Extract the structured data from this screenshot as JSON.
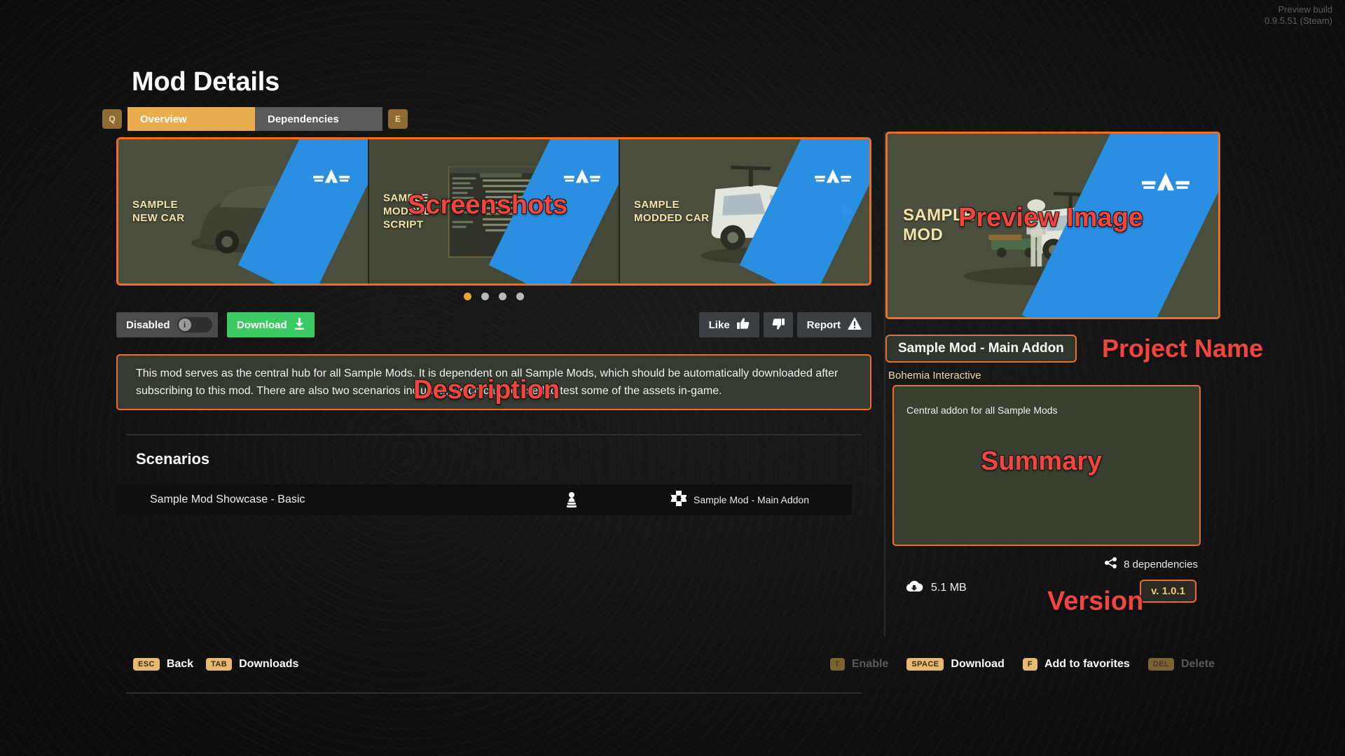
{
  "build": {
    "line1": "Preview build",
    "line2": "0.9.5.51 (Steam)"
  },
  "header": {
    "title": "Mod Details"
  },
  "tabs": {
    "left_key": "Q",
    "right_key": "E",
    "items": [
      {
        "label": "Overview",
        "active": true
      },
      {
        "label": "Dependencies",
        "active": false
      }
    ]
  },
  "carousel": {
    "shots": [
      {
        "label_line1": "SAMPLE",
        "label_line2": "NEW CAR"
      },
      {
        "label_line1": "SAMPLE",
        "label_line2": "MODDED",
        "label_line3": "SCRIPT"
      },
      {
        "label_line1": "SAMPLE",
        "label_line2": "MODDED CAR"
      }
    ],
    "dots": 4,
    "active_dot": 0,
    "next_icon": "chevron-right-icon"
  },
  "actions": {
    "toggle_label": "Disabled",
    "toggle_icon": "info-icon",
    "toggle_state": "off",
    "download_label": "Download",
    "download_icon": "download-icon",
    "like_label": "Like",
    "like_icon": "thumbs-up-icon",
    "dislike_icon": "thumbs-down-icon",
    "report_label": "Report",
    "report_icon": "warning-icon"
  },
  "description": {
    "text": "This mod serves as the central hub for all Sample Mods. It is dependent on all Sample Mods, which should be automatically downloaded after subscribing to this mod. There are also two scenarios included, which can be used to test some of the assets in-game."
  },
  "scenarios": {
    "title": "Scenarios",
    "rows": [
      {
        "name": "Sample Mod Showcase - Basic",
        "player_icon": "single-player-icon",
        "addon_icon": "puzzle-piece-icon",
        "addon_name": "Sample Mod - Main Addon"
      }
    ]
  },
  "sidebar": {
    "preview": {
      "label_line1": "SAMPLE",
      "label_line2": "MOD"
    },
    "project_name": "Sample Mod - Main Addon",
    "author": "Bohemia Interactive",
    "summary": "Central addon for all Sample Mods",
    "dependencies_count": "8 dependencies",
    "dependencies_icon": "network-nodes-icon",
    "size": "5.1 MB",
    "size_icon": "cloud-download-icon",
    "version": "v. 1.0.1"
  },
  "footer": {
    "left": [
      {
        "key": "ESC",
        "label": "Back",
        "enabled": true
      },
      {
        "key": "TAB",
        "label": "Downloads",
        "enabled": true
      }
    ],
    "right": [
      {
        "key": "T",
        "label": "Enable",
        "enabled": false
      },
      {
        "key": "SPACE",
        "label": "Download",
        "enabled": true
      },
      {
        "key": "F",
        "label": "Add to favorites",
        "enabled": true
      },
      {
        "key": "DEL",
        "label": "Delete",
        "enabled": false
      }
    ]
  },
  "annotations": {
    "screenshots": "Screenshots",
    "preview_image": "Preview Image",
    "project_name": "Project Name",
    "description": "Description",
    "summary": "Summary",
    "version": "Version"
  },
  "colors": {
    "accent_orange": "#e8702a",
    "tab_active": "#e9ac4e",
    "download_green": "#3ccb63",
    "annotation_red": "#f2453d",
    "panel_olive": "#3a4031",
    "stripe_blue": "#2a8fe0"
  }
}
